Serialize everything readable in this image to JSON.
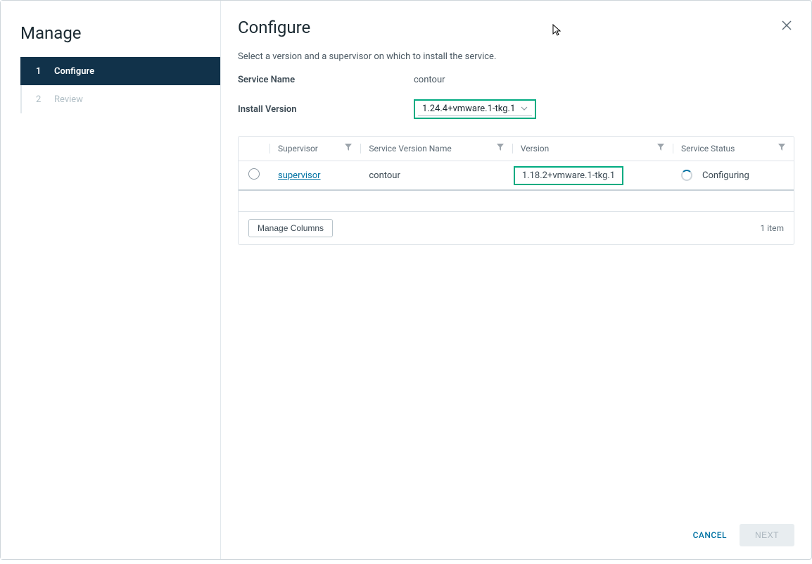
{
  "sidebar": {
    "title": "Manage",
    "steps": [
      {
        "num": "1",
        "label": "Configure"
      },
      {
        "num": "2",
        "label": "Review"
      }
    ]
  },
  "main": {
    "title": "Configure",
    "description": "Select a version and a supervisor on which to install the service.",
    "service_name_label": "Service Name",
    "service_name_value": "contour",
    "install_version_label": "Install Version",
    "install_version_value": "1.24.4+vmware.1-tkg.1"
  },
  "table": {
    "headers": {
      "supervisor": "Supervisor",
      "service_version_name": "Service Version Name",
      "version": "Version",
      "service_status": "Service Status"
    },
    "row": {
      "supervisor": "supervisor",
      "service_version_name": "contour",
      "version": "1.18.2+vmware.1-tkg.1",
      "service_status": "Configuring"
    },
    "manage_columns": "Manage Columns",
    "item_count": "1 item"
  },
  "footer": {
    "cancel": "CANCEL",
    "next": "NEXT"
  }
}
